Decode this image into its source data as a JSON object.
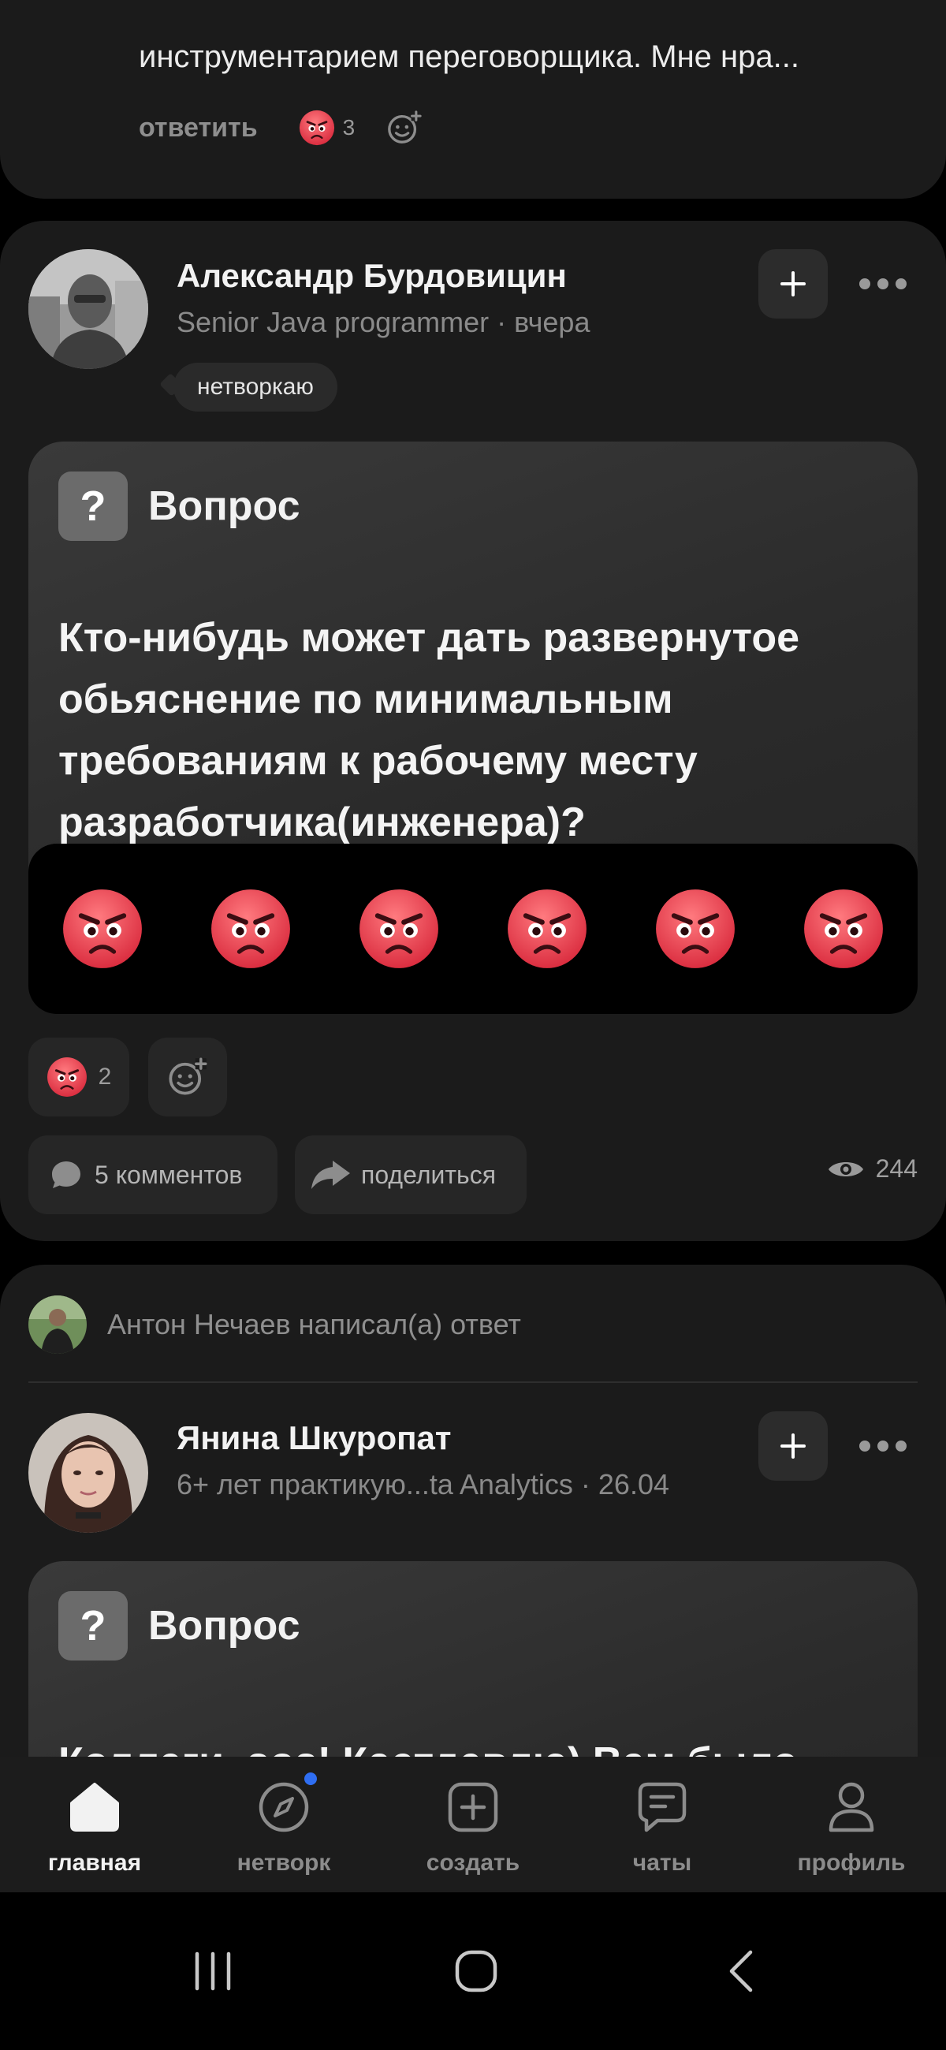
{
  "previous_comment": {
    "text": "инструментарием переговорщика. Мне нра...",
    "reply_label": "ответить",
    "reaction_count": "3"
  },
  "post1": {
    "author_name": "Александр Бурдовицин",
    "author_subtitle": "Senior Java programmer · вчера",
    "status": "нетворкаю",
    "question_label": "Вопрос",
    "question_text": "Кто-нибудь может дать развернутое обьяснение по минимальным требованиям к рабочему месту разработчика(инженера)?",
    "reaction_picker_icons": [
      "angry-face",
      "angry-face",
      "angry-face",
      "angry-face",
      "angry-face",
      "angry-face"
    ],
    "reaction_count": "2",
    "comments_label": "5 комментов",
    "share_label": "поделиться",
    "views_count": "244"
  },
  "post2": {
    "answer_notice": "Антон Нечаев написал(а) ответ",
    "author_name": "Янина Шкуропат",
    "author_subtitle": "6+ лет практикую...ta Analytics · 26.04",
    "question_label": "Вопрос",
    "question_text": "Коллеги, sos! Кастдевлю) Вам было"
  },
  "bottom_nav": {
    "items": [
      {
        "label": "главная",
        "icon": "home-icon",
        "active": true
      },
      {
        "label": "нетворк",
        "icon": "compass-icon",
        "badge": true
      },
      {
        "label": "создать",
        "icon": "plus-square-icon"
      },
      {
        "label": "чаты",
        "icon": "chat-icon"
      },
      {
        "label": "профиль",
        "icon": "person-icon"
      }
    ]
  },
  "colors": {
    "background": "#000000",
    "card": "#1b1b1b",
    "accent_dot": "#2f6ef2",
    "angry_emoji": "#e8474f"
  }
}
